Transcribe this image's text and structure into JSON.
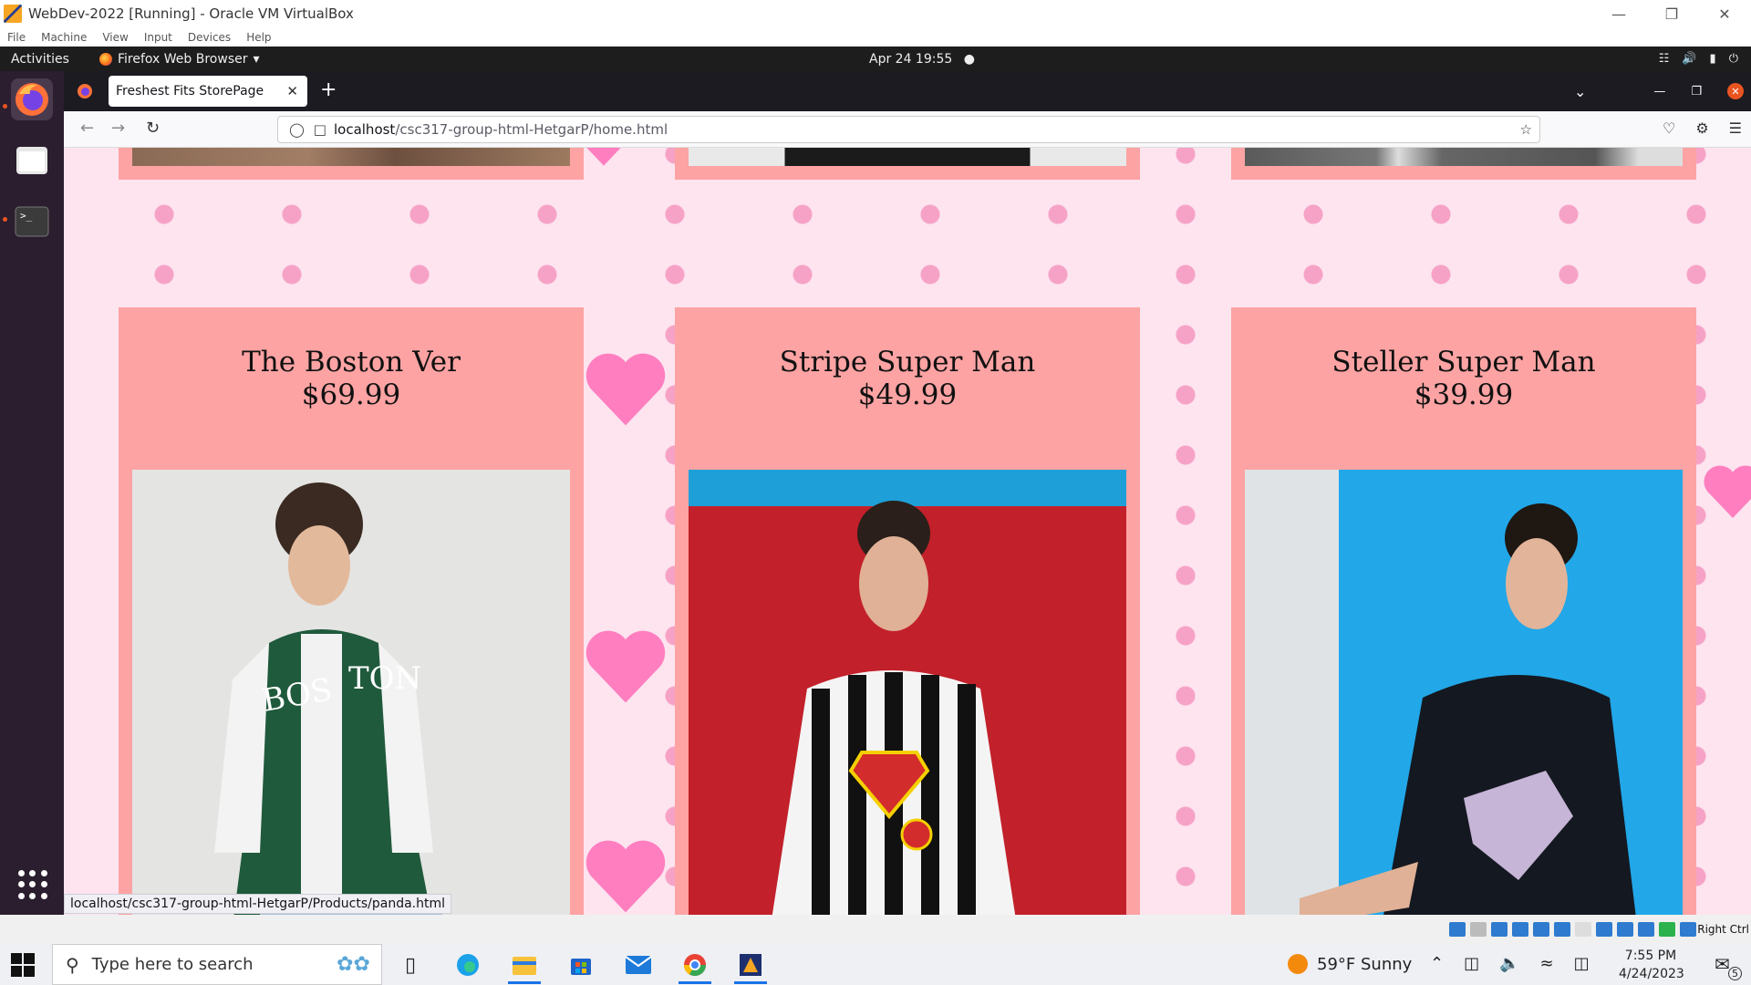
{
  "vbox": {
    "title": "WebDev-2022 [Running] - Oracle VM VirtualBox",
    "menu": [
      "File",
      "Machine",
      "View",
      "Input",
      "Devices",
      "Help"
    ],
    "host_key": "Right Ctrl"
  },
  "gnome": {
    "activities": "Activities",
    "app_menu": "Firefox Web Browser",
    "clock": "Apr 24  19:55"
  },
  "firefox": {
    "tab_title": "Freshest Fits StorePage",
    "url_host": "localhost",
    "url_path": "/csc317-group-html-HetgarP/home.html",
    "status_link": "localhost/csc317-group-html-HetgarP/Products/panda.html"
  },
  "products": [
    {
      "name": "The Boston Ver",
      "price": "$69.99"
    },
    {
      "name": "Stripe Super Man",
      "price": "$49.99"
    },
    {
      "name": "Steller Super Man",
      "price": "$39.99"
    }
  ],
  "taskbar": {
    "search_placeholder": "Type here to search",
    "weather": "59°F  Sunny",
    "time": "7:55 PM",
    "date": "4/24/2023",
    "notification_count": "5"
  },
  "colors": {
    "page_bg": "#fde4ef",
    "card_bg": "#fda3a3",
    "heart": "#ff7ec0",
    "accent": "#e95420"
  }
}
